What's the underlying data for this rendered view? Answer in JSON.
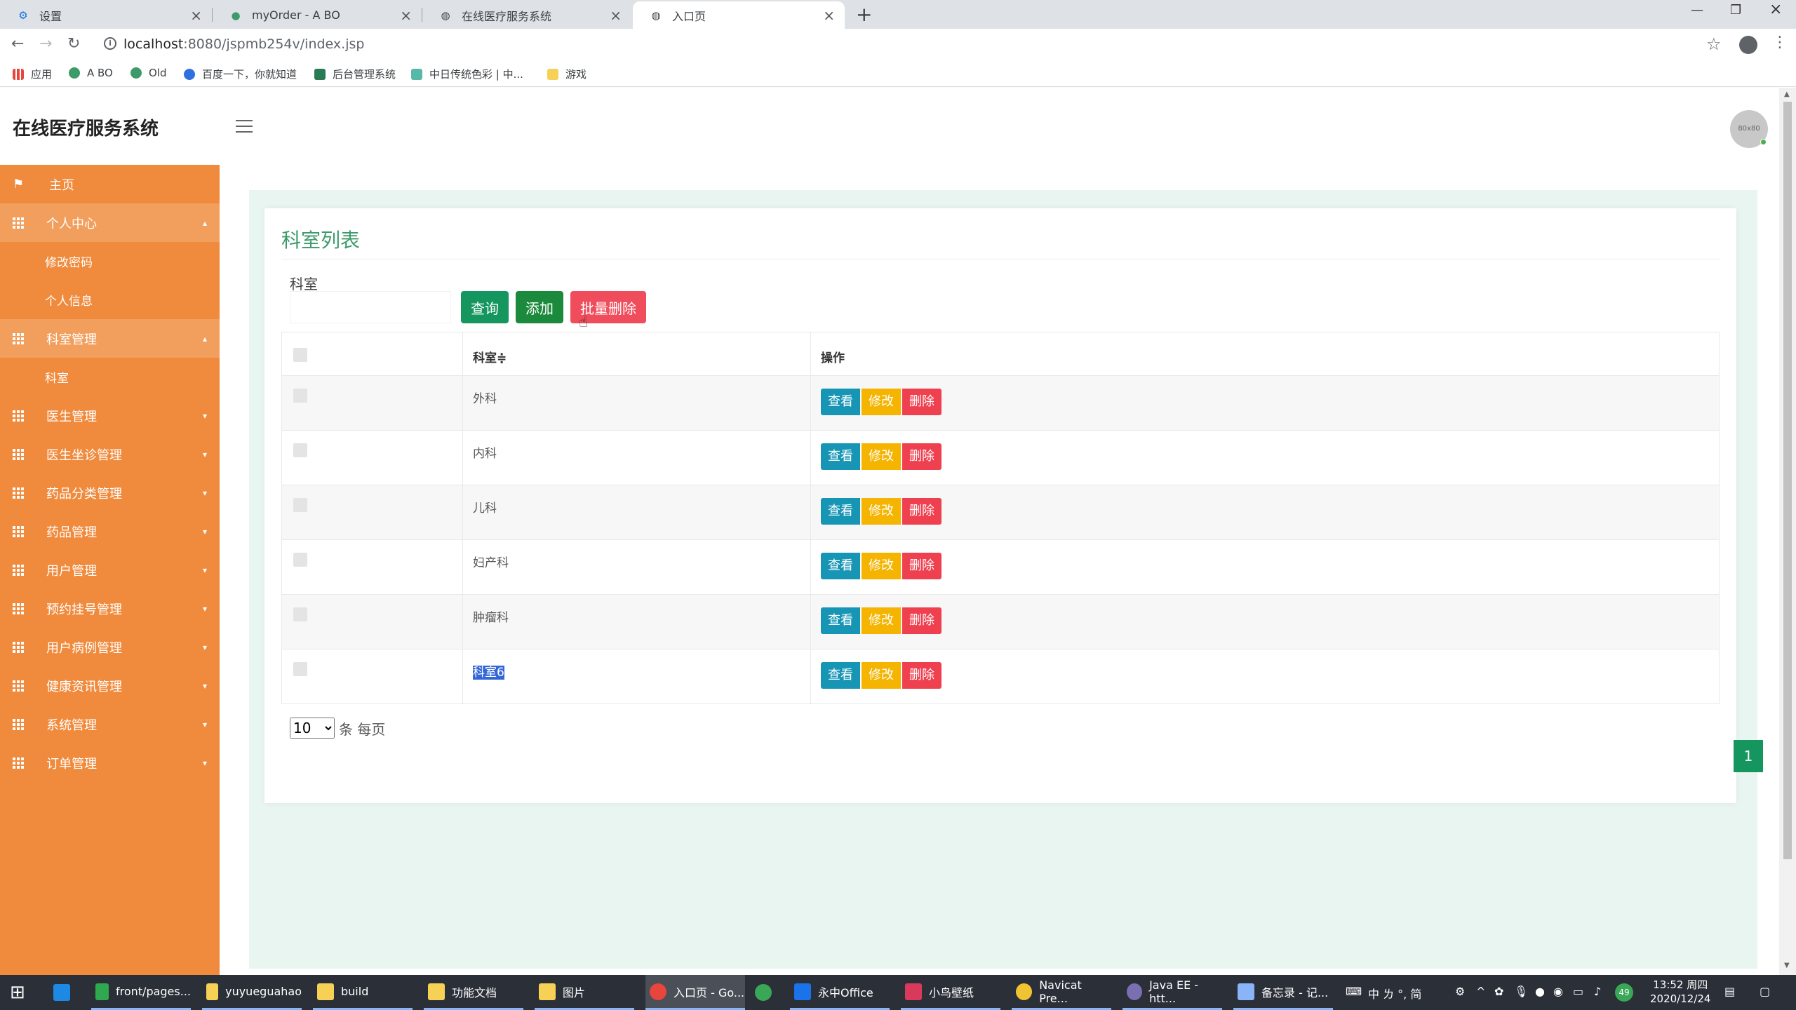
{
  "browser": {
    "tabs": [
      {
        "title": "设置"
      },
      {
        "title": "myOrder - A BO"
      },
      {
        "title": "在线医疗服务系统"
      },
      {
        "title": "入口页"
      }
    ],
    "url_host": "localhost",
    "url_rest": ":8080/jspmb254v/index.jsp",
    "bookmarks": [
      "应用",
      "A BO",
      "Old",
      "百度一下，你就知道",
      "后台管理系统",
      "中日传统色彩 | 中...",
      "游戏"
    ]
  },
  "app": {
    "title": "在线医疗服务系统",
    "avatar_text": "80x80"
  },
  "sidebar": {
    "home": "主页",
    "items": [
      {
        "label": "个人中心",
        "open": true,
        "children": [
          "修改密码",
          "个人信息"
        ]
      },
      {
        "label": "科室管理",
        "open": true,
        "children": [
          "科室"
        ]
      },
      {
        "label": "医生管理"
      },
      {
        "label": "医生坐诊管理"
      },
      {
        "label": "药品分类管理"
      },
      {
        "label": "药品管理"
      },
      {
        "label": "用户管理"
      },
      {
        "label": "预约挂号管理"
      },
      {
        "label": "用户病例管理"
      },
      {
        "label": "健康资讯管理"
      },
      {
        "label": "系统管理"
      },
      {
        "label": "订单管理"
      }
    ]
  },
  "main": {
    "card_title": "科室列表",
    "search_label": "科室",
    "search_value": "",
    "buttons": {
      "query": "查询",
      "add": "添加",
      "batch_delete": "批量删除"
    },
    "table": {
      "headers": [
        "科室",
        "操作"
      ],
      "sort_mark": "≑",
      "rows": [
        {
          "name": "外科"
        },
        {
          "name": "内科"
        },
        {
          "name": "儿科"
        },
        {
          "name": "妇产科"
        },
        {
          "name": "肿瘤科"
        },
        {
          "name": "科室6",
          "selected": true
        }
      ],
      "actions": {
        "view": "查看",
        "edit": "修改",
        "delete": "删除"
      }
    },
    "page_size": "10",
    "page_size_suffix": "条 每页",
    "current_page": "1"
  },
  "taskbar": {
    "items": [
      "front/pages...",
      "yuyueguahao",
      "build",
      "功能文档",
      "图片",
      "入口页 - Go...",
      "",
      "永中Office",
      "小鸟壁纸",
      "Navicat Pre...",
      "Java EE - htt...",
      "备忘录 - 记..."
    ],
    "tray_text": "中 ㄌ °, 简",
    "time": "13:52 周四",
    "date": "2020/12/24",
    "badge": "49"
  },
  "colors": {
    "sidebar": "#f08a3c",
    "primary_green": "#15965f",
    "danger": "#ef4050",
    "warning": "#f4b400",
    "info": "#1795b5"
  }
}
